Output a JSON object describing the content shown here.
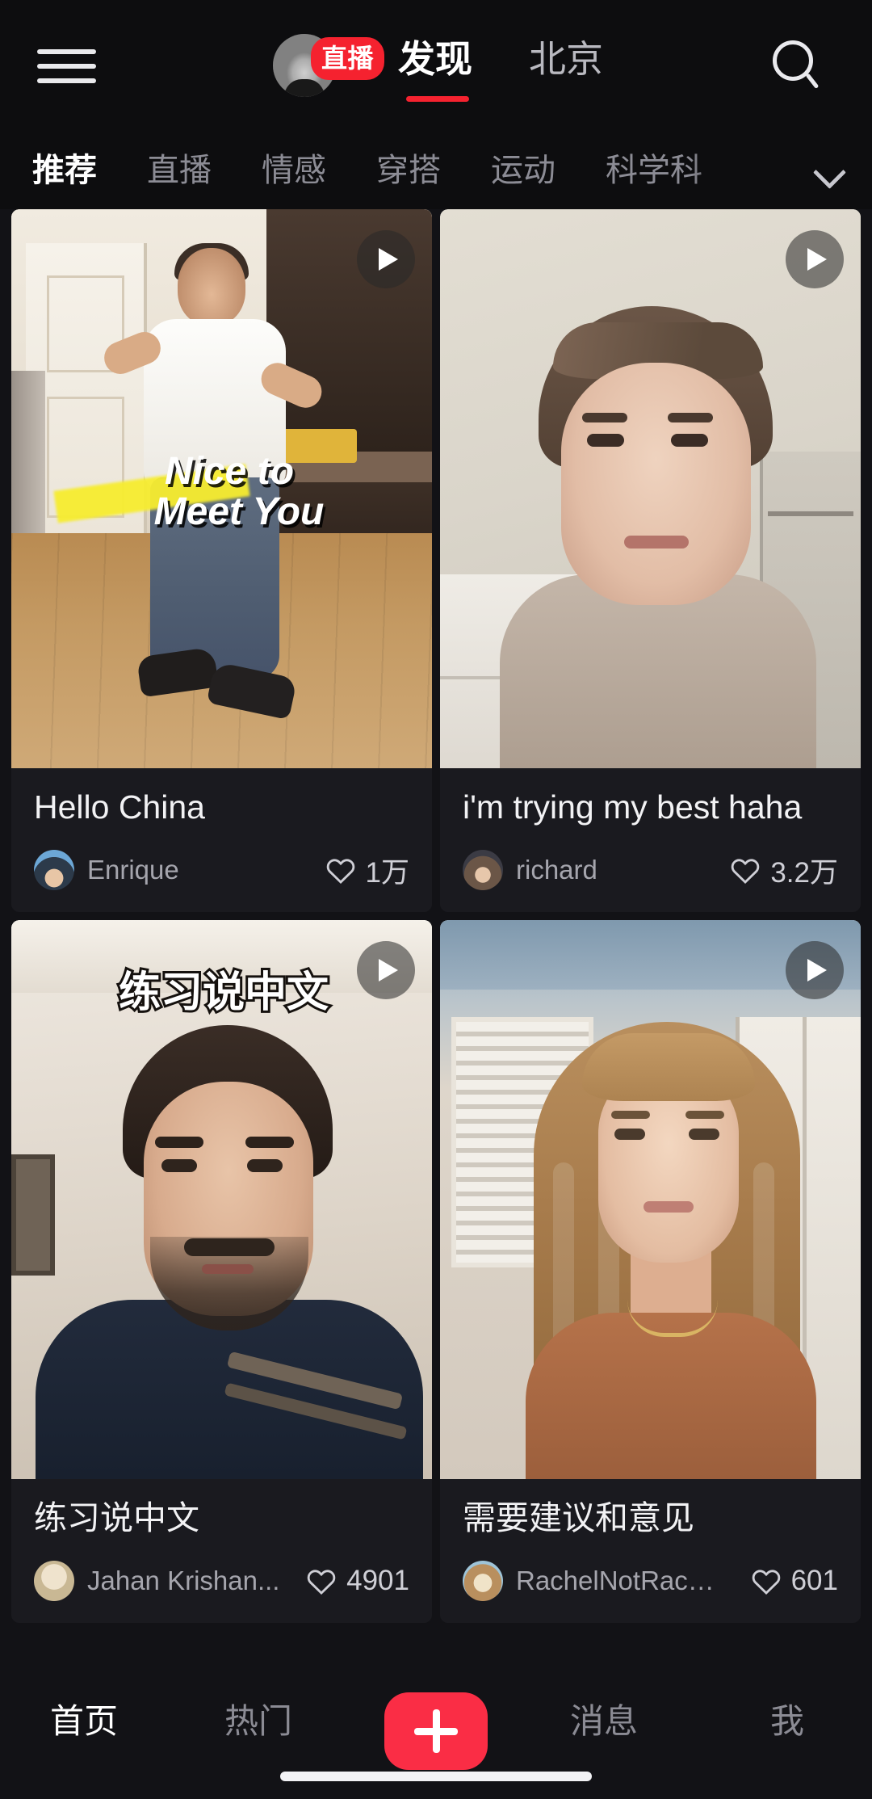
{
  "header": {
    "menu_icon": "hamburger-menu-icon",
    "search_icon": "search-icon",
    "live_badge": "直播",
    "avatar_alt": "live-user-avatar",
    "tabs": [
      {
        "label": "发现",
        "active": true
      },
      {
        "label": "北京",
        "active": false
      }
    ]
  },
  "categories": {
    "expand_icon": "chevron-down-icon",
    "items": [
      {
        "label": "推荐",
        "active": true
      },
      {
        "label": "直播",
        "active": false
      },
      {
        "label": "情感",
        "active": false
      },
      {
        "label": "穿搭",
        "active": false
      },
      {
        "label": "运动",
        "active": false
      },
      {
        "label": "科学科",
        "active": false
      }
    ]
  },
  "feed": {
    "cards": [
      {
        "title": "Hello China",
        "author": "Enrique",
        "likes": "1万",
        "overlay_line1": "Nice to",
        "overlay_line2": "Meet You",
        "play_icon": "play-icon",
        "like_icon": "heart-icon"
      },
      {
        "title": "i'm trying my best haha",
        "author": "richard",
        "likes": "3.2万",
        "overlay_line1": "",
        "overlay_line2": "",
        "play_icon": "play-icon",
        "like_icon": "heart-icon"
      },
      {
        "title": "练习说中文",
        "author": "Jahan Krishan...",
        "likes": "4901",
        "overlay_line1": "练习说中文",
        "overlay_line2": "",
        "play_icon": "play-icon",
        "like_icon": "heart-icon"
      },
      {
        "title": "需要建议和意见",
        "author": "RachelNotRach...",
        "likes": "601",
        "overlay_line1": "",
        "overlay_line2": "",
        "play_icon": "play-icon",
        "like_icon": "heart-icon"
      }
    ]
  },
  "bottom_nav": {
    "items": [
      {
        "label": "首页",
        "active": true
      },
      {
        "label": "热门",
        "active": false
      },
      {
        "label": "消息",
        "active": false
      },
      {
        "label": "我",
        "active": false
      }
    ],
    "create_icon": "plus-icon"
  },
  "colors": {
    "accent_red": "#fa2d45",
    "live_badge_red": "#f5222f",
    "background": "#121216",
    "bar_background": "#0d0d0f",
    "card_background": "#1a1a1f",
    "text_primary": "#ffffff",
    "text_secondary": "#8b8b94",
    "highlighter_yellow": "#f7ed30"
  }
}
